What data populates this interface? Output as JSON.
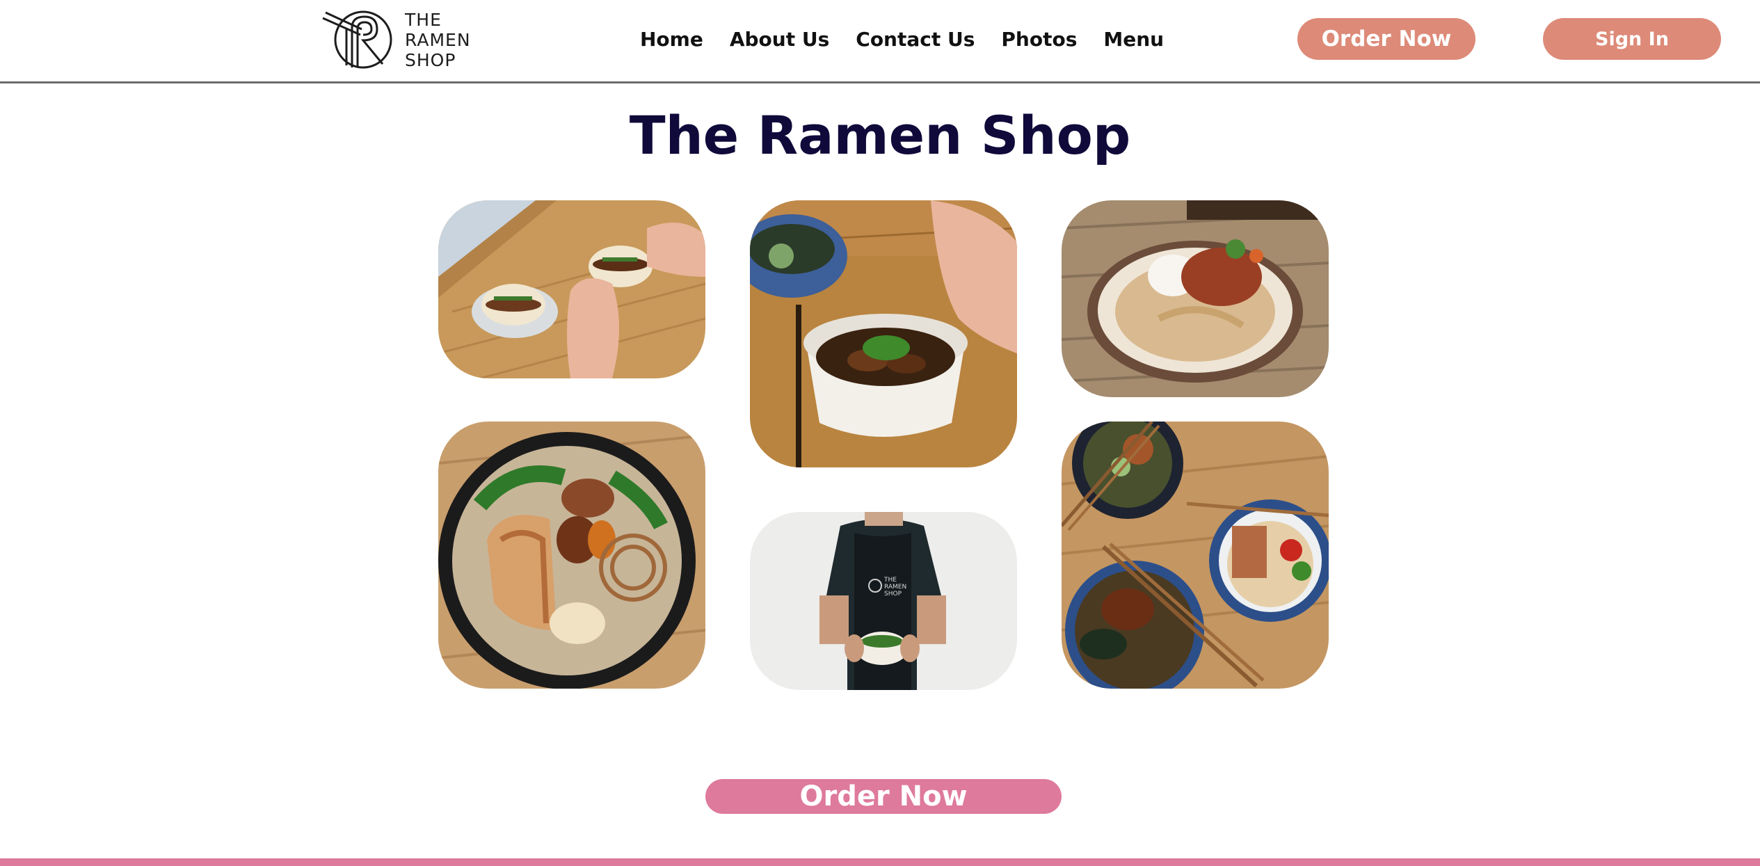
{
  "brand": {
    "logo_lines": [
      "THE",
      "RAMEN",
      "SHOP"
    ]
  },
  "nav": {
    "items": [
      "Home",
      "About Us",
      "Contact Us",
      "Photos",
      "Menu"
    ]
  },
  "header_actions": {
    "order_label": "Order Now",
    "signin_label": "Sign In"
  },
  "main": {
    "title": "The Ramen Shop",
    "order_label": "Order Now"
  },
  "photos": [
    {
      "name": "photo-bao-buns",
      "icon": "bao-buns-image"
    },
    {
      "name": "photo-tofu-bowl",
      "icon": "tofu-bowl-image"
    },
    {
      "name": "photo-noodle-plate",
      "icon": "noodle-plate-image"
    },
    {
      "name": "photo-pork-ramen",
      "icon": "pork-ramen-image"
    },
    {
      "name": "photo-chef-apron",
      "icon": "chef-apron-image"
    },
    {
      "name": "photo-ramen-bowls-chopsticks",
      "icon": "ramen-bowls-image"
    }
  ],
  "colors": {
    "accent_salmon": "#dd8a78",
    "accent_pink": "#de7a9b",
    "title_navy": "#0f0a3a",
    "divider": "#6b6b6b"
  }
}
